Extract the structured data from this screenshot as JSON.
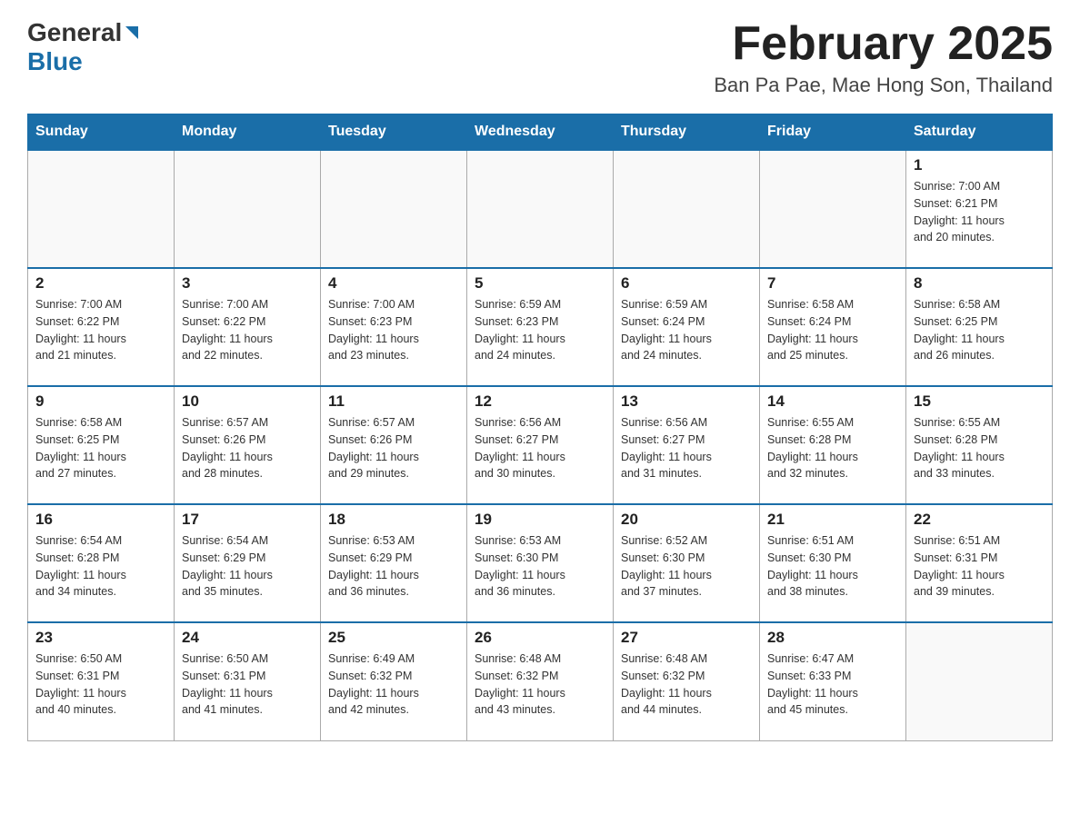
{
  "header": {
    "logo_general": "General",
    "logo_blue": "Blue",
    "month_title": "February 2025",
    "location": "Ban Pa Pae, Mae Hong Son, Thailand"
  },
  "days_of_week": [
    "Sunday",
    "Monday",
    "Tuesday",
    "Wednesday",
    "Thursday",
    "Friday",
    "Saturday"
  ],
  "weeks": [
    {
      "days": [
        {
          "number": "",
          "info": ""
        },
        {
          "number": "",
          "info": ""
        },
        {
          "number": "",
          "info": ""
        },
        {
          "number": "",
          "info": ""
        },
        {
          "number": "",
          "info": ""
        },
        {
          "number": "",
          "info": ""
        },
        {
          "number": "1",
          "info": "Sunrise: 7:00 AM\nSunset: 6:21 PM\nDaylight: 11 hours\nand 20 minutes."
        }
      ]
    },
    {
      "days": [
        {
          "number": "2",
          "info": "Sunrise: 7:00 AM\nSunset: 6:22 PM\nDaylight: 11 hours\nand 21 minutes."
        },
        {
          "number": "3",
          "info": "Sunrise: 7:00 AM\nSunset: 6:22 PM\nDaylight: 11 hours\nand 22 minutes."
        },
        {
          "number": "4",
          "info": "Sunrise: 7:00 AM\nSunset: 6:23 PM\nDaylight: 11 hours\nand 23 minutes."
        },
        {
          "number": "5",
          "info": "Sunrise: 6:59 AM\nSunset: 6:23 PM\nDaylight: 11 hours\nand 24 minutes."
        },
        {
          "number": "6",
          "info": "Sunrise: 6:59 AM\nSunset: 6:24 PM\nDaylight: 11 hours\nand 24 minutes."
        },
        {
          "number": "7",
          "info": "Sunrise: 6:58 AM\nSunset: 6:24 PM\nDaylight: 11 hours\nand 25 minutes."
        },
        {
          "number": "8",
          "info": "Sunrise: 6:58 AM\nSunset: 6:25 PM\nDaylight: 11 hours\nand 26 minutes."
        }
      ]
    },
    {
      "days": [
        {
          "number": "9",
          "info": "Sunrise: 6:58 AM\nSunset: 6:25 PM\nDaylight: 11 hours\nand 27 minutes."
        },
        {
          "number": "10",
          "info": "Sunrise: 6:57 AM\nSunset: 6:26 PM\nDaylight: 11 hours\nand 28 minutes."
        },
        {
          "number": "11",
          "info": "Sunrise: 6:57 AM\nSunset: 6:26 PM\nDaylight: 11 hours\nand 29 minutes."
        },
        {
          "number": "12",
          "info": "Sunrise: 6:56 AM\nSunset: 6:27 PM\nDaylight: 11 hours\nand 30 minutes."
        },
        {
          "number": "13",
          "info": "Sunrise: 6:56 AM\nSunset: 6:27 PM\nDaylight: 11 hours\nand 31 minutes."
        },
        {
          "number": "14",
          "info": "Sunrise: 6:55 AM\nSunset: 6:28 PM\nDaylight: 11 hours\nand 32 minutes."
        },
        {
          "number": "15",
          "info": "Sunrise: 6:55 AM\nSunset: 6:28 PM\nDaylight: 11 hours\nand 33 minutes."
        }
      ]
    },
    {
      "days": [
        {
          "number": "16",
          "info": "Sunrise: 6:54 AM\nSunset: 6:28 PM\nDaylight: 11 hours\nand 34 minutes."
        },
        {
          "number": "17",
          "info": "Sunrise: 6:54 AM\nSunset: 6:29 PM\nDaylight: 11 hours\nand 35 minutes."
        },
        {
          "number": "18",
          "info": "Sunrise: 6:53 AM\nSunset: 6:29 PM\nDaylight: 11 hours\nand 36 minutes."
        },
        {
          "number": "19",
          "info": "Sunrise: 6:53 AM\nSunset: 6:30 PM\nDaylight: 11 hours\nand 36 minutes."
        },
        {
          "number": "20",
          "info": "Sunrise: 6:52 AM\nSunset: 6:30 PM\nDaylight: 11 hours\nand 37 minutes."
        },
        {
          "number": "21",
          "info": "Sunrise: 6:51 AM\nSunset: 6:30 PM\nDaylight: 11 hours\nand 38 minutes."
        },
        {
          "number": "22",
          "info": "Sunrise: 6:51 AM\nSunset: 6:31 PM\nDaylight: 11 hours\nand 39 minutes."
        }
      ]
    },
    {
      "days": [
        {
          "number": "23",
          "info": "Sunrise: 6:50 AM\nSunset: 6:31 PM\nDaylight: 11 hours\nand 40 minutes."
        },
        {
          "number": "24",
          "info": "Sunrise: 6:50 AM\nSunset: 6:31 PM\nDaylight: 11 hours\nand 41 minutes."
        },
        {
          "number": "25",
          "info": "Sunrise: 6:49 AM\nSunset: 6:32 PM\nDaylight: 11 hours\nand 42 minutes."
        },
        {
          "number": "26",
          "info": "Sunrise: 6:48 AM\nSunset: 6:32 PM\nDaylight: 11 hours\nand 43 minutes."
        },
        {
          "number": "27",
          "info": "Sunrise: 6:48 AM\nSunset: 6:32 PM\nDaylight: 11 hours\nand 44 minutes."
        },
        {
          "number": "28",
          "info": "Sunrise: 6:47 AM\nSunset: 6:33 PM\nDaylight: 11 hours\nand 45 minutes."
        },
        {
          "number": "",
          "info": ""
        }
      ]
    }
  ]
}
